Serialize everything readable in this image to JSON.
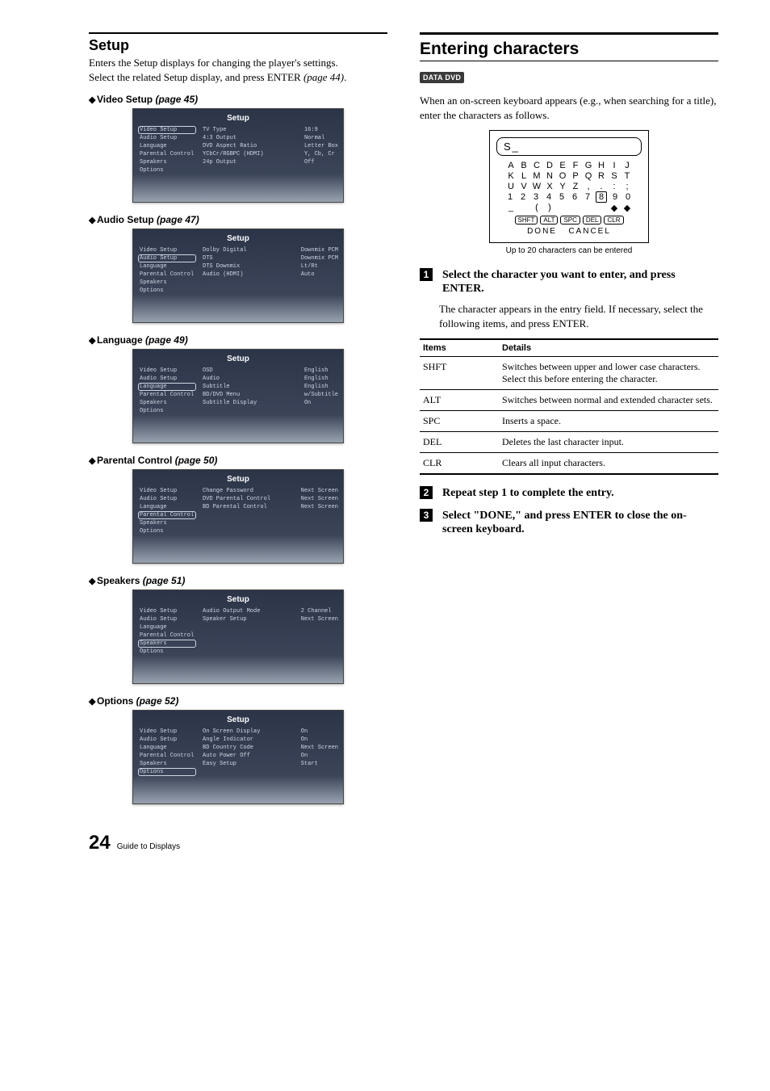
{
  "left": {
    "title": "Setup",
    "intro1": "Enters the Setup displays for changing the player's settings.",
    "intro2_a": "Select the related Setup display, and press ENTER ",
    "intro2_b": "(page 44)",
    "intro2_c": ".",
    "menuItems": [
      "Video Setup",
      "Audio Setup",
      "Language",
      "Parental Control",
      "Speakers",
      "Options"
    ],
    "screens": [
      {
        "heading": "Video Setup",
        "pageRef": "(page 45)",
        "selectedIndex": 0,
        "title": "Setup",
        "settings": [
          {
            "label": "TV Type",
            "value": "16:9"
          },
          {
            "label": "4:3 Output",
            "value": "Normal"
          },
          {
            "label": "DVD Aspect Ratio",
            "value": "Letter Box"
          },
          {
            "label": "YCbCr/RGBPC (HDMI)",
            "value": "Y, Cb, Cr"
          },
          {
            "label": "24p Output",
            "value": "Off"
          }
        ]
      },
      {
        "heading": "Audio Setup",
        "pageRef": "(page 47)",
        "selectedIndex": 1,
        "title": "Setup",
        "settings": [
          {
            "label": "Dolby Digital",
            "value": "Downmix PCM"
          },
          {
            "label": "DTS",
            "value": "Downmix PCM"
          },
          {
            "label": "DTS Downmix",
            "value": "Lt/Rt"
          },
          {
            "label": "Audio (HDMI)",
            "value": "Auto"
          }
        ]
      },
      {
        "heading": "Language",
        "pageRef": "(page 49)",
        "selectedIndex": 2,
        "title": "Setup",
        "settings": [
          {
            "label": "OSD",
            "value": "English"
          },
          {
            "label": "Audio",
            "value": "English"
          },
          {
            "label": "Subtitle",
            "value": "English"
          },
          {
            "label": "BD/DVD Menu",
            "value": "w/Subtitle"
          },
          {
            "label": "Subtitle Display",
            "value": "On"
          }
        ]
      },
      {
        "heading": "Parental Control",
        "pageRef": "(page 50)",
        "selectedIndex": 3,
        "title": "Setup",
        "settings": [
          {
            "label": "Change Password",
            "value": "Next Screen"
          },
          {
            "label": "DVD Parental Control",
            "value": "Next Screen"
          },
          {
            "label": "BD Parental Control",
            "value": "Next Screen"
          }
        ]
      },
      {
        "heading": "Speakers",
        "pageRef": "(page 51)",
        "selectedIndex": 4,
        "title": "Setup",
        "settings": [
          {
            "label": "Audio Output Mode",
            "value": "2 Channel"
          },
          {
            "label": "Speaker Setup",
            "value": "Next Screen"
          }
        ]
      },
      {
        "heading": "Options",
        "pageRef": "(page 52)",
        "selectedIndex": 5,
        "title": "Setup",
        "settings": [
          {
            "label": "On Screen Display",
            "value": "On"
          },
          {
            "label": "Angle Indicator",
            "value": "On"
          },
          {
            "label": "BD Country Code",
            "value": "Next Screen"
          },
          {
            "label": "Auto Power Off",
            "value": "On"
          },
          {
            "label": "Easy Setup",
            "value": "Start"
          }
        ]
      }
    ]
  },
  "right": {
    "title": "Entering characters",
    "badge": "DATA DVD",
    "intro": "When an on-screen keyboard appears (e.g., when searching for a title), enter the characters as follows.",
    "kbd": {
      "entry": "S_",
      "rows": [
        [
          "A",
          "B",
          "C",
          "D",
          "E",
          "F",
          "G",
          "H",
          "I",
          "J"
        ],
        [
          "K",
          "L",
          "M",
          "N",
          "O",
          "P",
          "Q",
          "R",
          "S",
          "T"
        ],
        [
          "U",
          "V",
          "W",
          "X",
          "Y",
          "Z",
          ",",
          ".",
          ":",
          ";"
        ],
        [
          "1",
          "2",
          "3",
          "4",
          "5",
          "6",
          "7",
          "8",
          "9",
          "0"
        ],
        [
          "_",
          "",
          "(",
          ")",
          "",
          "",
          "",
          "",
          "◆",
          "◆"
        ]
      ],
      "selectedRow": 3,
      "selectedCol": 7,
      "fn": [
        "SHFT",
        "ALT",
        "SPC",
        "DEL",
        "CLR"
      ],
      "done": "DONE",
      "cancel": "CANCEL"
    },
    "caption": "Up to 20 characters can be entered",
    "step1_title": "Select the character you want to enter, and press ENTER.",
    "step1_body": "The character appears in the entry field. If necessary, select the following items, and press ENTER.",
    "table": {
      "h1": "Items",
      "h2": "Details",
      "rows": [
        {
          "k": "SHFT",
          "v": "Switches between upper and lower case characters. Select this before entering the character."
        },
        {
          "k": "ALT",
          "v": "Switches between normal and extended character sets."
        },
        {
          "k": "SPC",
          "v": "Inserts a space."
        },
        {
          "k": "DEL",
          "v": "Deletes the last character input."
        },
        {
          "k": "CLR",
          "v": "Clears all input characters."
        }
      ]
    },
    "step2": "Repeat step 1 to complete the entry.",
    "step3": "Select \"DONE,\" and press ENTER to close the on-screen keyboard."
  },
  "footer": {
    "page": "24",
    "label": "Guide to Displays"
  }
}
